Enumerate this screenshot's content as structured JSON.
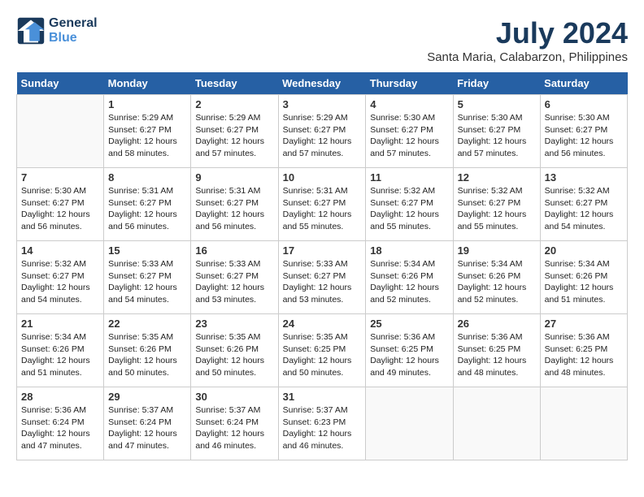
{
  "header": {
    "logo_line1": "General",
    "logo_line2": "Blue",
    "month_year": "July 2024",
    "location": "Santa Maria, Calabarzon, Philippines"
  },
  "weekdays": [
    "Sunday",
    "Monday",
    "Tuesday",
    "Wednesday",
    "Thursday",
    "Friday",
    "Saturday"
  ],
  "weeks": [
    [
      {
        "day": "",
        "info": ""
      },
      {
        "day": "1",
        "info": "Sunrise: 5:29 AM\nSunset: 6:27 PM\nDaylight: 12 hours\nand 58 minutes."
      },
      {
        "day": "2",
        "info": "Sunrise: 5:29 AM\nSunset: 6:27 PM\nDaylight: 12 hours\nand 57 minutes."
      },
      {
        "day": "3",
        "info": "Sunrise: 5:29 AM\nSunset: 6:27 PM\nDaylight: 12 hours\nand 57 minutes."
      },
      {
        "day": "4",
        "info": "Sunrise: 5:30 AM\nSunset: 6:27 PM\nDaylight: 12 hours\nand 57 minutes."
      },
      {
        "day": "5",
        "info": "Sunrise: 5:30 AM\nSunset: 6:27 PM\nDaylight: 12 hours\nand 57 minutes."
      },
      {
        "day": "6",
        "info": "Sunrise: 5:30 AM\nSunset: 6:27 PM\nDaylight: 12 hours\nand 56 minutes."
      }
    ],
    [
      {
        "day": "7",
        "info": "Sunrise: 5:30 AM\nSunset: 6:27 PM\nDaylight: 12 hours\nand 56 minutes."
      },
      {
        "day": "8",
        "info": "Sunrise: 5:31 AM\nSunset: 6:27 PM\nDaylight: 12 hours\nand 56 minutes."
      },
      {
        "day": "9",
        "info": "Sunrise: 5:31 AM\nSunset: 6:27 PM\nDaylight: 12 hours\nand 56 minutes."
      },
      {
        "day": "10",
        "info": "Sunrise: 5:31 AM\nSunset: 6:27 PM\nDaylight: 12 hours\nand 55 minutes."
      },
      {
        "day": "11",
        "info": "Sunrise: 5:32 AM\nSunset: 6:27 PM\nDaylight: 12 hours\nand 55 minutes."
      },
      {
        "day": "12",
        "info": "Sunrise: 5:32 AM\nSunset: 6:27 PM\nDaylight: 12 hours\nand 55 minutes."
      },
      {
        "day": "13",
        "info": "Sunrise: 5:32 AM\nSunset: 6:27 PM\nDaylight: 12 hours\nand 54 minutes."
      }
    ],
    [
      {
        "day": "14",
        "info": "Sunrise: 5:32 AM\nSunset: 6:27 PM\nDaylight: 12 hours\nand 54 minutes."
      },
      {
        "day": "15",
        "info": "Sunrise: 5:33 AM\nSunset: 6:27 PM\nDaylight: 12 hours\nand 54 minutes."
      },
      {
        "day": "16",
        "info": "Sunrise: 5:33 AM\nSunset: 6:27 PM\nDaylight: 12 hours\nand 53 minutes."
      },
      {
        "day": "17",
        "info": "Sunrise: 5:33 AM\nSunset: 6:27 PM\nDaylight: 12 hours\nand 53 minutes."
      },
      {
        "day": "18",
        "info": "Sunrise: 5:34 AM\nSunset: 6:26 PM\nDaylight: 12 hours\nand 52 minutes."
      },
      {
        "day": "19",
        "info": "Sunrise: 5:34 AM\nSunset: 6:26 PM\nDaylight: 12 hours\nand 52 minutes."
      },
      {
        "day": "20",
        "info": "Sunrise: 5:34 AM\nSunset: 6:26 PM\nDaylight: 12 hours\nand 51 minutes."
      }
    ],
    [
      {
        "day": "21",
        "info": "Sunrise: 5:34 AM\nSunset: 6:26 PM\nDaylight: 12 hours\nand 51 minutes."
      },
      {
        "day": "22",
        "info": "Sunrise: 5:35 AM\nSunset: 6:26 PM\nDaylight: 12 hours\nand 50 minutes."
      },
      {
        "day": "23",
        "info": "Sunrise: 5:35 AM\nSunset: 6:26 PM\nDaylight: 12 hours\nand 50 minutes."
      },
      {
        "day": "24",
        "info": "Sunrise: 5:35 AM\nSunset: 6:25 PM\nDaylight: 12 hours\nand 50 minutes."
      },
      {
        "day": "25",
        "info": "Sunrise: 5:36 AM\nSunset: 6:25 PM\nDaylight: 12 hours\nand 49 minutes."
      },
      {
        "day": "26",
        "info": "Sunrise: 5:36 AM\nSunset: 6:25 PM\nDaylight: 12 hours\nand 48 minutes."
      },
      {
        "day": "27",
        "info": "Sunrise: 5:36 AM\nSunset: 6:25 PM\nDaylight: 12 hours\nand 48 minutes."
      }
    ],
    [
      {
        "day": "28",
        "info": "Sunrise: 5:36 AM\nSunset: 6:24 PM\nDaylight: 12 hours\nand 47 minutes."
      },
      {
        "day": "29",
        "info": "Sunrise: 5:37 AM\nSunset: 6:24 PM\nDaylight: 12 hours\nand 47 minutes."
      },
      {
        "day": "30",
        "info": "Sunrise: 5:37 AM\nSunset: 6:24 PM\nDaylight: 12 hours\nand 46 minutes."
      },
      {
        "day": "31",
        "info": "Sunrise: 5:37 AM\nSunset: 6:23 PM\nDaylight: 12 hours\nand 46 minutes."
      },
      {
        "day": "",
        "info": ""
      },
      {
        "day": "",
        "info": ""
      },
      {
        "day": "",
        "info": ""
      }
    ]
  ]
}
